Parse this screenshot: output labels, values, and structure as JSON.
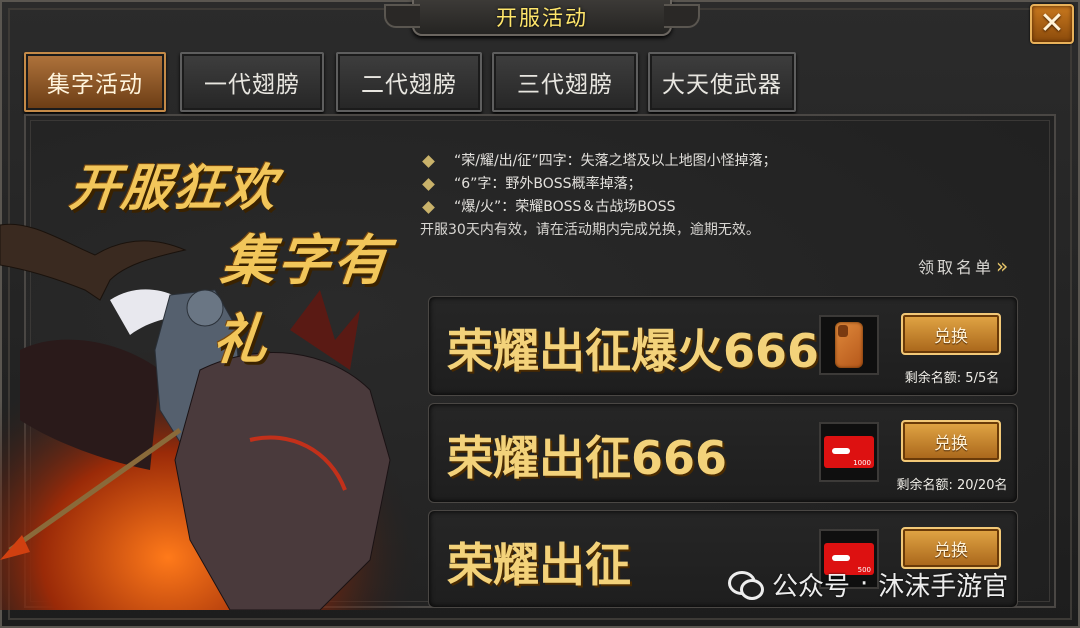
{
  "window": {
    "title": "开服活动",
    "close_glyph": "✕"
  },
  "tabs": [
    {
      "label": "集字活动",
      "active": true
    },
    {
      "label": "一代翅膀",
      "active": false
    },
    {
      "label": "二代翅膀",
      "active": false
    },
    {
      "label": "三代翅膀",
      "active": false
    },
    {
      "label": "大天使武器",
      "active": false
    }
  ],
  "banner": {
    "line1": "开服狂欢",
    "line2": "集字有礼"
  },
  "rules": [
    "“荣/耀/出/征”四字：失落之塔及以上地图小怪掉落；",
    "“6”字：野外BOSS概率掉落；",
    "“爆/火”：荣耀BOSS＆古战场BOSS"
  ],
  "rule_note": "开服30天内有效，请在活动期内完成兑换，逾期无效。",
  "list_link": {
    "label": "领取名单",
    "chevron": "»"
  },
  "rewards": [
    {
      "title": "荣耀出征爆火666",
      "prize_icon": "phone-icon",
      "button": "兑换",
      "remaining": "剩余名额: 5/5名"
    },
    {
      "title": "荣耀出征666",
      "prize_icon": "red-card-icon",
      "card_value": "1000",
      "button": "兑换",
      "remaining": "剩余名额: 20/20名"
    },
    {
      "title": "荣耀出征",
      "prize_icon": "red-card-icon",
      "card_value": "500",
      "button": "兑换",
      "remaining": ""
    }
  ],
  "watermark": {
    "left": "公众号",
    "sep": "·",
    "right": "沐沫手游官"
  },
  "colors": {
    "gold": "#f3d27a",
    "title_yellow": "#ffe66b",
    "button_orange": "#d08a2e",
    "active_tab": "#a0642a"
  }
}
